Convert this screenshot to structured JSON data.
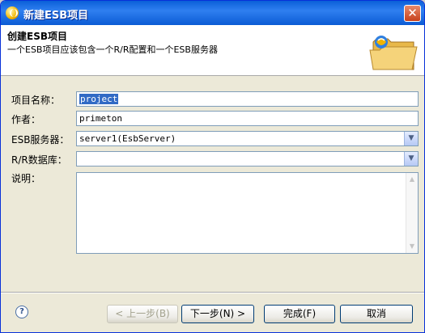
{
  "window": {
    "title": "新建ESB项目",
    "close_glyph": "✕"
  },
  "banner": {
    "title": "创建ESB项目",
    "description": "一个ESB项目应该包含一个R/R配置和一个ESB服务器",
    "icon": "folder-icon"
  },
  "form": {
    "project_name": {
      "label": "项目名称：",
      "value": "project"
    },
    "author": {
      "label": "作者：",
      "value": "primeton"
    },
    "esb_server": {
      "label": "ESB服务器：",
      "value": "server1(EsbServer)"
    },
    "rr_database": {
      "label": "R/R数据库：",
      "value": ""
    },
    "description": {
      "label": "说明：",
      "value": ""
    }
  },
  "footer": {
    "help_glyph": "?",
    "back_label": "< 上一步(B)",
    "next_label": "下一步(N) >",
    "finish_label": "完成(F)",
    "cancel_label": "取消"
  }
}
